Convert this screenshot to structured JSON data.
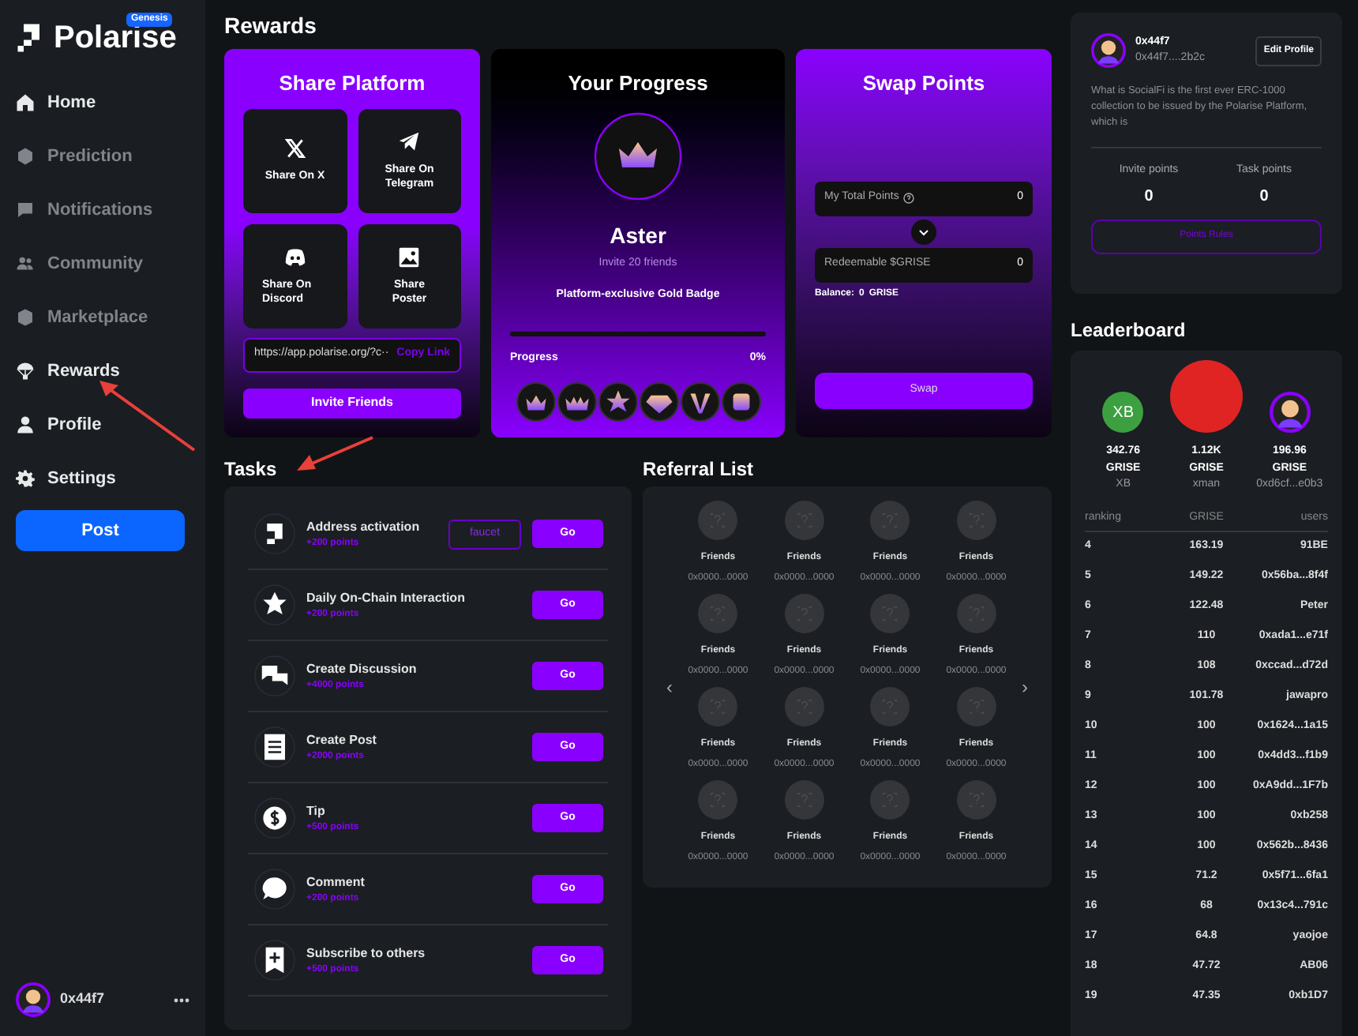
{
  "sidebar": {
    "logo": {
      "text": "Polarise",
      "badge": "Genesis"
    },
    "items": [
      {
        "label": "Home",
        "dimmed": false
      },
      {
        "label": "Prediction",
        "dimmed": true
      },
      {
        "label": "Notifications",
        "dimmed": true
      },
      {
        "label": "Community",
        "dimmed": true
      },
      {
        "label": "Marketplace",
        "dimmed": true
      },
      {
        "label": "Rewards",
        "dimmed": false
      },
      {
        "label": "Profile",
        "dimmed": false
      },
      {
        "label": "Settings",
        "dimmed": false
      }
    ],
    "post_button": "Post",
    "user": {
      "name": "0x44f7"
    }
  },
  "rewards": {
    "title": "Rewards",
    "share": {
      "title": "Share Platform",
      "options": [
        {
          "label": "Share On X"
        },
        {
          "label": "Share On Telegram"
        },
        {
          "label": "Share On Discord"
        },
        {
          "label": "Share Poster"
        }
      ],
      "link": "https://app.polarise.org/?c···",
      "copy": "Copy Link",
      "invite_button": "Invite Friends"
    },
    "progress": {
      "title": "Your Progress",
      "level_name": "Aster",
      "requirement": "Invite 20 friends",
      "reward": "Platform-exclusive Gold Badge",
      "progress_label": "Progress",
      "progress_value": "0%",
      "level": 0
    },
    "swap": {
      "title": "Swap Points",
      "total_label": "My Total Points",
      "total_value": "0",
      "redeem_label": "Redeemable $GRISE",
      "redeem_value": "0",
      "balance_label": "Balance:",
      "balance_value": "0",
      "balance_unit": "GRISE",
      "button": "Swap"
    }
  },
  "tasks": {
    "title": "Tasks",
    "items": [
      {
        "title": "Address activation",
        "points": "+200 points",
        "extra_button": "faucet",
        "button": "Go"
      },
      {
        "title": "Daily On-Chain Interaction",
        "points": "+200 points",
        "button": "Go"
      },
      {
        "title": "Create Discussion",
        "points": "+4000 points",
        "button": "Go"
      },
      {
        "title": "Create Post",
        "points": "+2000 points",
        "button": "Go"
      },
      {
        "title": "Tip",
        "points": "+500 points",
        "button": "Go"
      },
      {
        "title": "Comment",
        "points": "+200 points",
        "button": "Go"
      },
      {
        "title": "Subscribe to others",
        "points": "+500 points",
        "button": "Go"
      }
    ]
  },
  "referrals": {
    "title": "Referral List",
    "prev": "‹",
    "next": "›",
    "friends": [
      {
        "label": "Friends",
        "address": "0x0000...0000"
      },
      {
        "label": "Friends",
        "address": "0x0000...0000"
      },
      {
        "label": "Friends",
        "address": "0x0000...0000"
      },
      {
        "label": "Friends",
        "address": "0x0000...0000"
      },
      {
        "label": "Friends",
        "address": "0x0000...0000"
      },
      {
        "label": "Friends",
        "address": "0x0000...0000"
      },
      {
        "label": "Friends",
        "address": "0x0000...0000"
      },
      {
        "label": "Friends",
        "address": "0x0000...0000"
      },
      {
        "label": "Friends",
        "address": "0x0000...0000"
      },
      {
        "label": "Friends",
        "address": "0x0000...0000"
      },
      {
        "label": "Friends",
        "address": "0x0000...0000"
      },
      {
        "label": "Friends",
        "address": "0x0000...0000"
      },
      {
        "label": "Friends",
        "address": "0x0000...0000"
      },
      {
        "label": "Friends",
        "address": "0x0000...0000"
      },
      {
        "label": "Friends",
        "address": "0x0000...0000"
      },
      {
        "label": "Friends",
        "address": "0x0000...0000"
      }
    ]
  },
  "profile": {
    "name": "0x44f7",
    "address": "0x44f7....2b2c",
    "edit_button": "Edit Profile",
    "bio": "What is SocialFi is the first ever ERC-1000 collection to be issued by the Polarise Platform, which is",
    "stats": [
      {
        "label": "Invite points",
        "value": "0"
      },
      {
        "label": "Task points",
        "value": "0"
      }
    ],
    "rules_button": "Points Rules"
  },
  "leaderboard": {
    "title": "Leaderboard",
    "top": [
      {
        "initials": "XB",
        "amount": "342.76",
        "unit": "GRISE",
        "name": "XB"
      },
      {
        "amount": "1.12K",
        "unit": "GRISE",
        "name": "xman"
      },
      {
        "amount": "196.96",
        "unit": "GRISE",
        "name": "0xd6cf...e0b3"
      }
    ],
    "columns": [
      "ranking",
      "GRISE",
      "users"
    ],
    "rows": [
      [
        "4",
        "163.19",
        "91BE"
      ],
      [
        "5",
        "149.22",
        "0x56ba...8f4f"
      ],
      [
        "6",
        "122.48",
        "Peter"
      ],
      [
        "7",
        "110",
        "0xada1...e71f"
      ],
      [
        "8",
        "108",
        "0xccad...d72d"
      ],
      [
        "9",
        "101.78",
        "jawapro"
      ],
      [
        "10",
        "100",
        "0x1624...1a15"
      ],
      [
        "11",
        "100",
        "0x4dd3...f1b9"
      ],
      [
        "12",
        "100",
        "0xA9dd...1F7b"
      ],
      [
        "13",
        "100",
        "0xb258"
      ],
      [
        "14",
        "100",
        "0x562b...8436"
      ],
      [
        "15",
        "71.2",
        "0x5f71...6fa1"
      ],
      [
        "16",
        "68",
        "0x13c4...791c"
      ],
      [
        "17",
        "64.8",
        "yaojoe"
      ],
      [
        "18",
        "47.72",
        "AB06"
      ],
      [
        "19",
        "47.35",
        "0xb1D7"
      ]
    ]
  }
}
